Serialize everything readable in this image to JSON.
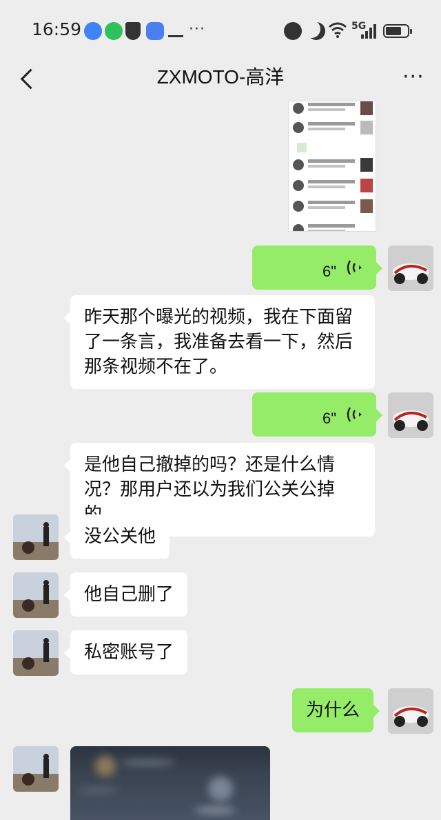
{
  "status_bar": {
    "time": "16:59",
    "dots": "···",
    "network": "5G"
  },
  "header": {
    "title": "ZXMOTO-高洋",
    "more": "···"
  },
  "messages": [
    {
      "id": "m1",
      "side": "right",
      "type": "voice",
      "duration": "6\""
    },
    {
      "id": "m2",
      "side": "left-noavatar",
      "type": "text",
      "text": "昨天那个曝光的视频，我在下面留了一条言，我准备去看一下，然后那条视频不在了。"
    },
    {
      "id": "m3",
      "side": "right",
      "type": "voice",
      "duration": "6\""
    },
    {
      "id": "m4",
      "side": "left-noavatar",
      "type": "text",
      "text": "是他自己撤掉的吗？还是什么情况？那用户还以为我们公关公掉的。"
    },
    {
      "id": "m5",
      "side": "left",
      "type": "text",
      "text": "没公关他"
    },
    {
      "id": "m6",
      "side": "left",
      "type": "text",
      "text": "他自己删了"
    },
    {
      "id": "m7",
      "side": "left",
      "type": "text",
      "text": "私密账号了"
    },
    {
      "id": "m8",
      "side": "right",
      "type": "text",
      "text": "为什么"
    }
  ],
  "icons": {
    "back": "back-arrow-icon",
    "more": "more-icon",
    "voice": "voice-wave-icon"
  },
  "colors": {
    "background": "#ededed",
    "sent_bubble": "#95ec69",
    "received_bubble": "#ffffff"
  }
}
